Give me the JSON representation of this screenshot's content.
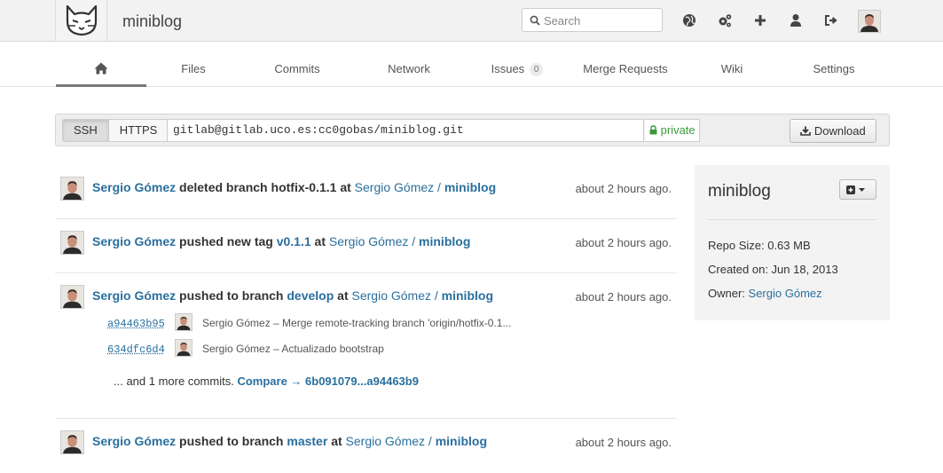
{
  "header": {
    "app_title": "miniblog",
    "search_placeholder": "Search",
    "icons": [
      "globe-icon",
      "cogs-icon",
      "plus-icon",
      "user-icon",
      "sign-out-icon"
    ]
  },
  "tabs": [
    {
      "label": "",
      "icon": "home-icon",
      "active": true
    },
    {
      "label": "Files"
    },
    {
      "label": "Commits"
    },
    {
      "label": "Network"
    },
    {
      "label": "Issues",
      "badge": "0"
    },
    {
      "label": "Merge Requests"
    },
    {
      "label": "Wiki"
    },
    {
      "label": "Settings"
    }
  ],
  "clone": {
    "ssh_label": "SSH",
    "https_label": "HTTPS",
    "url": "gitlab@gitlab.uco.es:cc0gobas/miniblog.git",
    "visibility": "private",
    "download_label": "Download"
  },
  "events": [
    {
      "author": "Sergio Gómez",
      "action": "deleted branch",
      "ref": "hotfix-0.1.1",
      "at": "at",
      "project_owner": "Sergio Gómez /",
      "project": "miniblog",
      "time": "about 2 hours ago."
    },
    {
      "author": "Sergio Gómez",
      "action": "pushed new tag",
      "ref": "v0.1.1",
      "at": "at",
      "project_owner": "Sergio Gómez /",
      "project": "miniblog",
      "time": "about 2 hours ago."
    },
    {
      "author": "Sergio Gómez",
      "action": "pushed to branch",
      "ref": "develop",
      "at": "at",
      "project_owner": "Sergio Gómez /",
      "project": "miniblog",
      "time": "about 2 hours ago.",
      "commits": [
        {
          "sha": "a94463b95",
          "message": "Sergio Gómez – Merge remote-tracking branch 'origin/hotfix-0.1..."
        },
        {
          "sha": "634dfc6d4",
          "message": "Sergio Gómez – Actualizado bootstrap"
        }
      ],
      "more_text": "... and 1 more commits.",
      "compare_text": "Compare → 6b091079...a94463b9"
    },
    {
      "author": "Sergio Gómez",
      "action": "pushed to branch",
      "ref": "master",
      "at": "at",
      "project_owner": "Sergio Gómez /",
      "project": "miniblog",
      "time": "about 2 hours ago."
    }
  ],
  "sidebar": {
    "title": "miniblog",
    "repo_size": "Repo Size: 0.63 MB",
    "created_on": "Created on: Jun 18, 2013",
    "owner_label": "Owner:",
    "owner_name": "Sergio Gómez"
  },
  "colors": {
    "link": "#2a6f9e",
    "private_green": "#3c9a3c",
    "header_bg": "#f2f2f2"
  }
}
